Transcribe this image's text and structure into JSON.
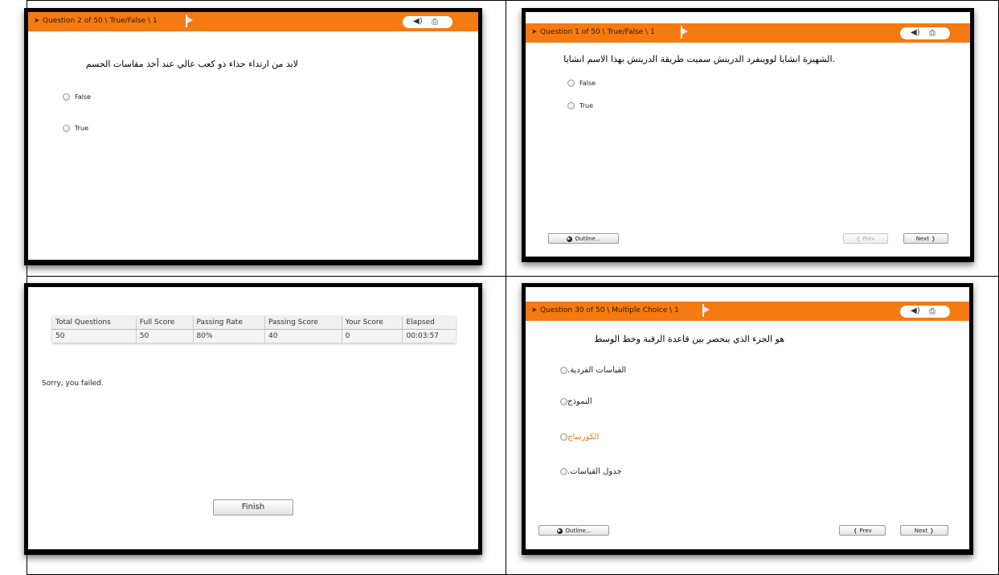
{
  "q2": {
    "title": "Question 2 of 50 \\ True/False \\ 1",
    "question": "لابد من ارتداء حذاء ذو كعب عالي عند أخذ مقاسات الجسم",
    "options": [
      "False",
      "True"
    ]
  },
  "q1": {
    "title": "Question 1 of 50 \\ True/False \\ 1",
    "question": ".الشهيرة انشايا لووينفرد الدريتش سميت طريقة الدريتش بهذا الاسم انشايا",
    "options": [
      "False",
      "True"
    ],
    "outline_label": "Outline...",
    "prev_label": "❬ Prev",
    "next_label": "Next ❭"
  },
  "results": {
    "headers": [
      "Total Questions",
      "Full Score",
      "Passing Rate",
      "Passing Score",
      "Your Score",
      "Elapsed"
    ],
    "values": [
      "50",
      "50",
      "80%",
      "40",
      "0",
      "00:03:57"
    ],
    "message": "Sorry, you failed.",
    "finish_label": "Finish"
  },
  "q30": {
    "title": "Question 30 of 50 \\ Multiple Choice \\ 1",
    "question": "هو الجزء الذي ينحصر بين قاعدة الرقبة وخط الوسط",
    "options": [
      ".القياسات الفردية",
      "النموذج",
      "الكورساج",
      ".جدول القياسات"
    ],
    "highlight_color": "#f47a11",
    "outline_label": "Outline...",
    "prev_label": "❬ Prev",
    "next_label": "Next ❭"
  },
  "icons": {
    "speaker": "speaker-icon",
    "print": "print-icon",
    "flag": "flag-icon",
    "radio": "radio-icon"
  },
  "colors": {
    "bar": "#f47a11",
    "frame": "#000000"
  }
}
